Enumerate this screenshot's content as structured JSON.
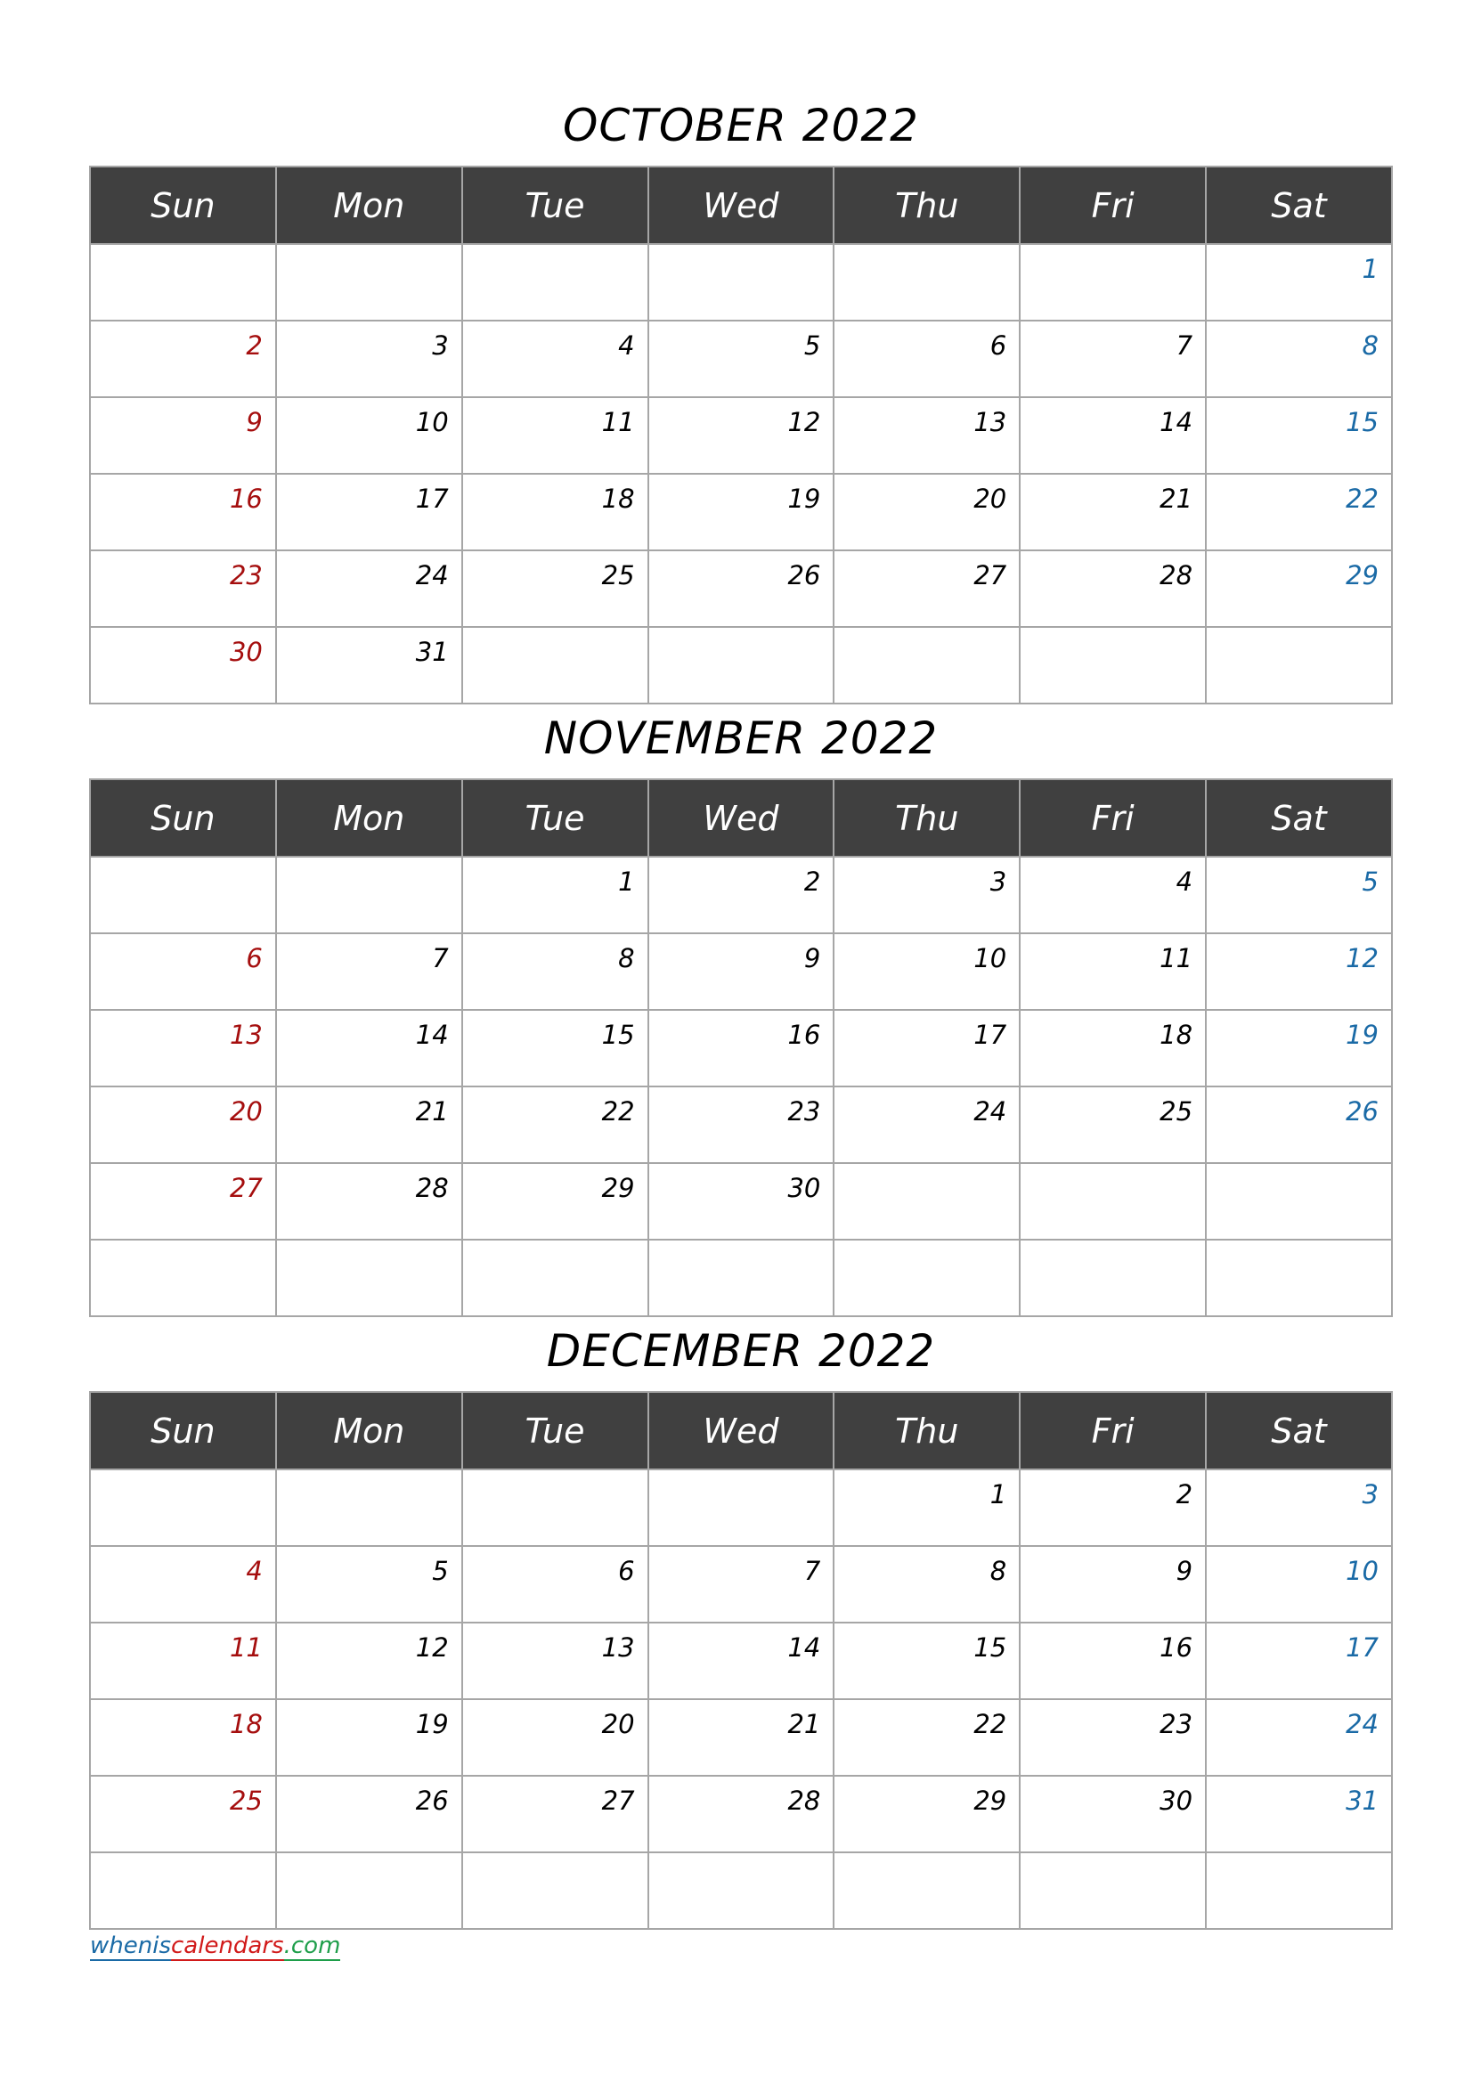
{
  "weekdays": [
    "Sun",
    "Mon",
    "Tue",
    "Wed",
    "Thu",
    "Fri",
    "Sat"
  ],
  "colors": {
    "header_bg": "#404040",
    "sunday": "#a50e0e",
    "saturday": "#1a6aa6",
    "grid": "#a6a6a6"
  },
  "months": [
    {
      "title": "OCTOBER 2022",
      "weeks": [
        [
          "",
          "",
          "",
          "",
          "",
          "",
          "1"
        ],
        [
          "2",
          "3",
          "4",
          "5",
          "6",
          "7",
          "8"
        ],
        [
          "9",
          "10",
          "11",
          "12",
          "13",
          "14",
          "15"
        ],
        [
          "16",
          "17",
          "18",
          "19",
          "20",
          "21",
          "22"
        ],
        [
          "23",
          "24",
          "25",
          "26",
          "27",
          "28",
          "29"
        ],
        [
          "30",
          "31",
          "",
          "",
          "",
          "",
          ""
        ]
      ]
    },
    {
      "title": "NOVEMBER 2022",
      "weeks": [
        [
          "",
          "",
          "1",
          "2",
          "3",
          "4",
          "5"
        ],
        [
          "6",
          "7",
          "8",
          "9",
          "10",
          "11",
          "12"
        ],
        [
          "13",
          "14",
          "15",
          "16",
          "17",
          "18",
          "19"
        ],
        [
          "20",
          "21",
          "22",
          "23",
          "24",
          "25",
          "26"
        ],
        [
          "27",
          "28",
          "29",
          "30",
          "",
          "",
          ""
        ],
        [
          "",
          "",
          "",
          "",
          "",
          "",
          ""
        ]
      ]
    },
    {
      "title": "DECEMBER 2022",
      "weeks": [
        [
          "",
          "",
          "",
          "",
          "1",
          "2",
          "3"
        ],
        [
          "4",
          "5",
          "6",
          "7",
          "8",
          "9",
          "10"
        ],
        [
          "11",
          "12",
          "13",
          "14",
          "15",
          "16",
          "17"
        ],
        [
          "18",
          "19",
          "20",
          "21",
          "22",
          "23",
          "24"
        ],
        [
          "25",
          "26",
          "27",
          "28",
          "29",
          "30",
          "31"
        ],
        [
          "",
          "",
          "",
          "",
          "",
          "",
          ""
        ]
      ]
    }
  ],
  "footer": {
    "parts": [
      {
        "text": "whenis",
        "color": "#1a6aa6"
      },
      {
        "text": "calendars",
        "color": "#d11a1a"
      },
      {
        "text": ".com",
        "color": "#1e9e4a"
      }
    ]
  }
}
